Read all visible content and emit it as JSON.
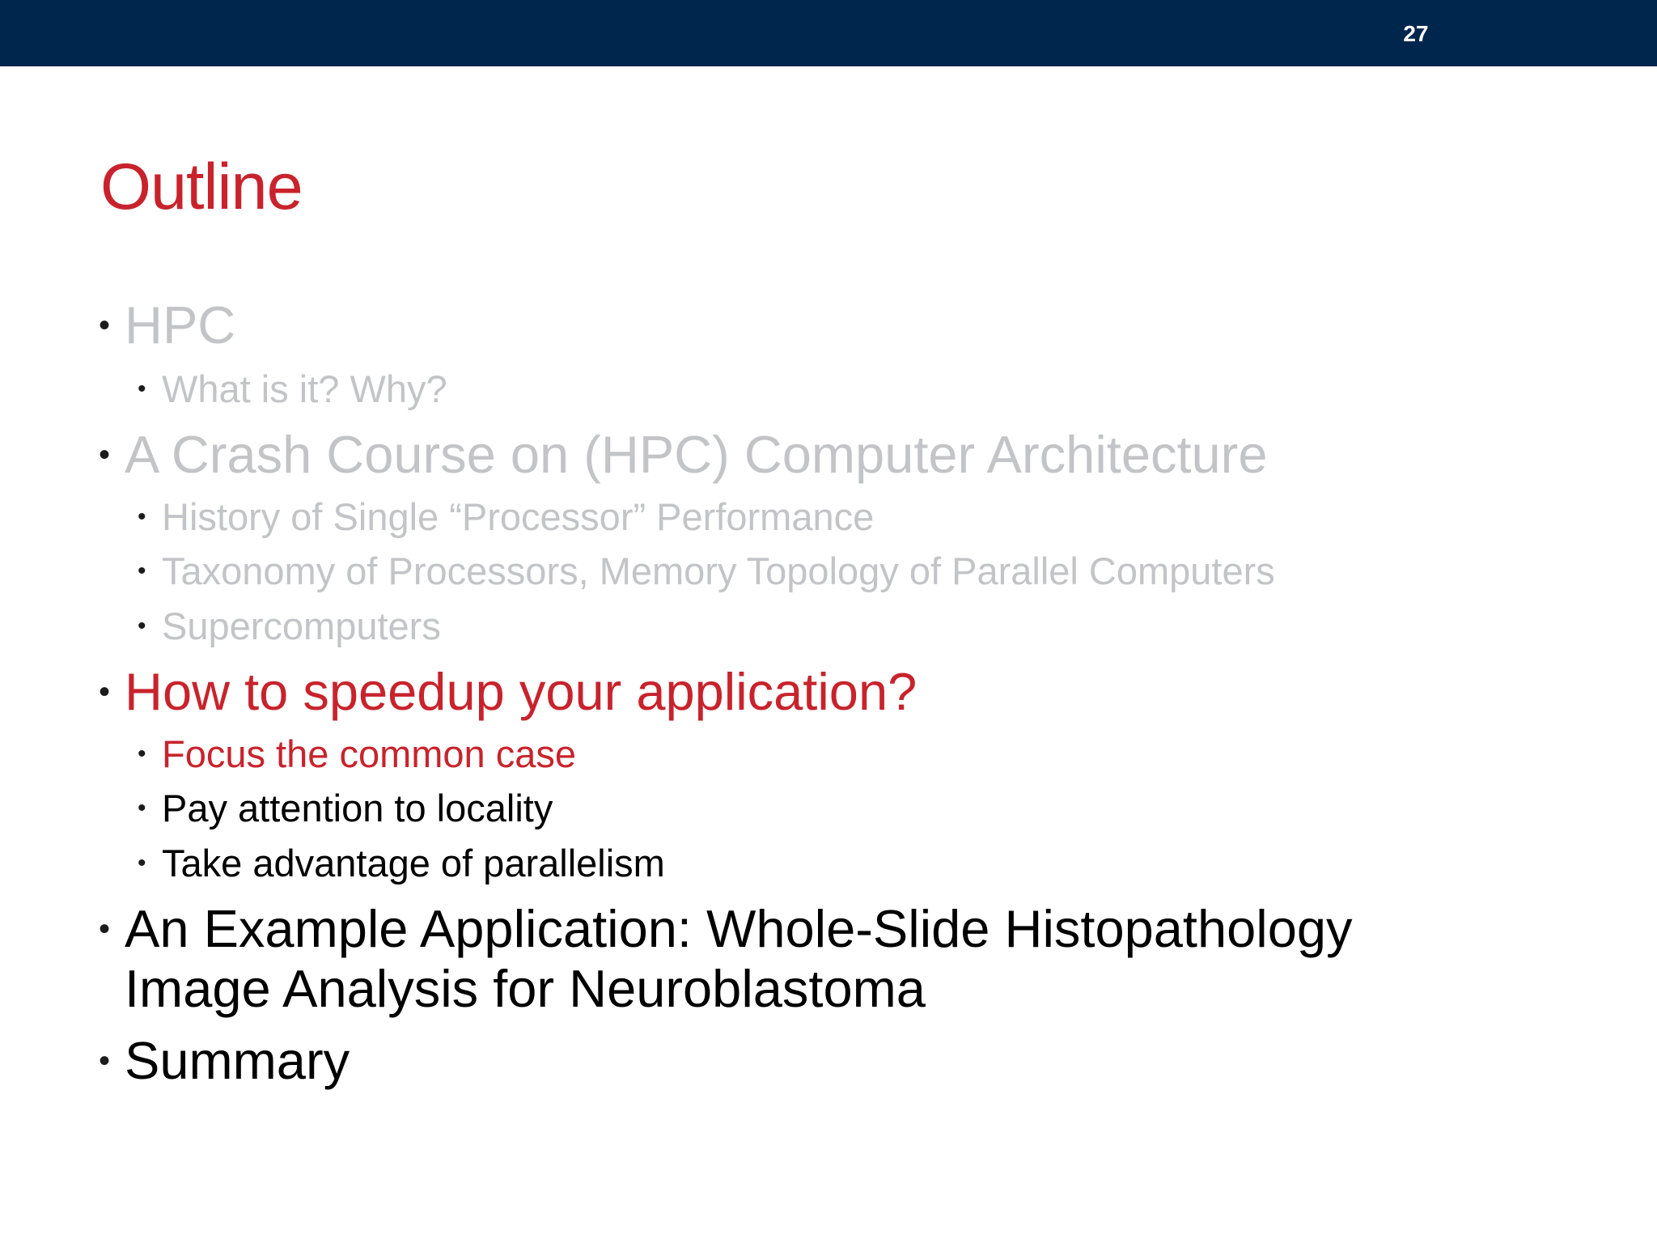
{
  "slide": {
    "number": "27",
    "title": "Outline",
    "colors": {
      "header_bar": "#00264d",
      "title": "#c8232c",
      "current_section": "#c8232c",
      "completed_section": "#c3c4c7",
      "upcoming_section": "#000000"
    }
  },
  "outline": [
    {
      "level": 1,
      "state": "done",
      "text": "HPC"
    },
    {
      "level": 2,
      "state": "done",
      "text": "What is it? Why?"
    },
    {
      "level": 1,
      "state": "done",
      "text": "A Crash Course on (HPC) Computer Architecture"
    },
    {
      "level": 2,
      "state": "done",
      "text": "History of Single “Processor” Performance"
    },
    {
      "level": 2,
      "state": "done",
      "text": "Taxonomy of Processors, Memory Topology of Parallel Computers"
    },
    {
      "level": 2,
      "state": "done",
      "text": "Supercomputers"
    },
    {
      "level": 1,
      "state": "current",
      "text": "How to speedup your application?"
    },
    {
      "level": 2,
      "state": "current",
      "text": "Focus the common case"
    },
    {
      "level": 2,
      "state": "upcoming",
      "text": "Pay attention to locality"
    },
    {
      "level": 2,
      "state": "upcoming",
      "text": "Take advantage of parallelism"
    },
    {
      "level": 1,
      "state": "upcoming",
      "text": "An Example Application: Whole-Slide Histopathology Image Analysis for Neuroblastoma"
    },
    {
      "level": 1,
      "state": "upcoming",
      "text": "Summary"
    }
  ]
}
